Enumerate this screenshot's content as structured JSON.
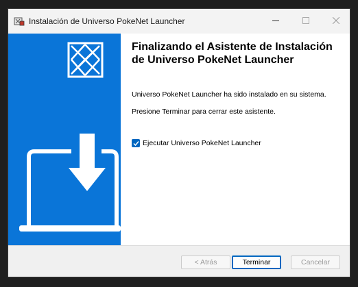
{
  "window": {
    "title": "Instalación de Universo PokeNet Launcher",
    "icons": {
      "app": "installer-app-icon",
      "minimize": "minimize-icon",
      "maximize": "maximize-icon",
      "close": "close-icon"
    }
  },
  "sidebar": {
    "background": "#0a75d8",
    "logo_icon": "pokenet-logo-icon",
    "illustration_icon": "laptop-download-icon"
  },
  "content": {
    "heading": "Finalizando el Asistente de Instalación de Universo PokeNet Launcher",
    "installed_text": "Universo PokeNet Launcher ha sido instalado en su sistema.",
    "instruction_text": "Presione Terminar para cerrar este asistente.",
    "run_checkbox": {
      "label": "Ejecutar Universo PokeNet Launcher",
      "checked": true
    }
  },
  "footer": {
    "back_label": "< Atrás",
    "finish_label": "Terminar",
    "cancel_label": "Cancelar"
  },
  "colors": {
    "accent": "#0067c0",
    "sidebar": "#0a75d8"
  }
}
